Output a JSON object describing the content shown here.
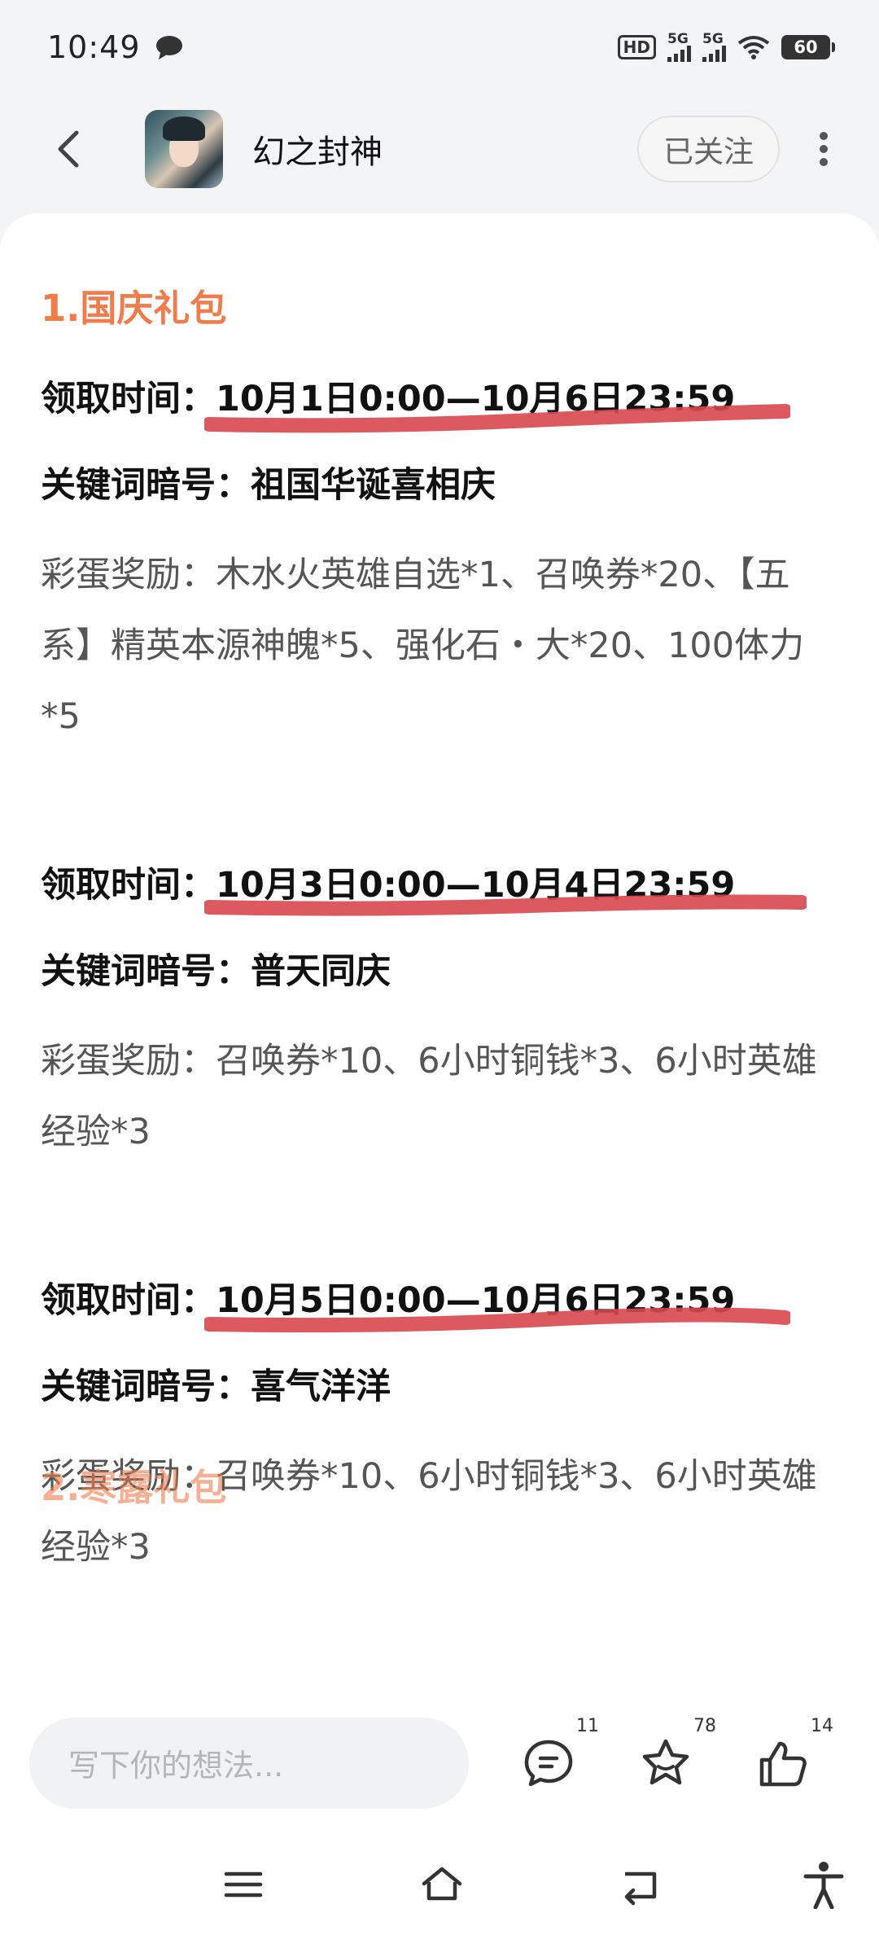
{
  "status_bar": {
    "time": "10:49",
    "hd": "HD",
    "signal1": "5G",
    "signal2": "5G",
    "battery": "60"
  },
  "header": {
    "title": "幻之封神",
    "follow_label": "已关注"
  },
  "article": {
    "section_title": "1.国庆礼包",
    "time_label": "领取时间：",
    "key_label": "关键词暗号：",
    "blocks": [
      {
        "time": "10月1日0:00—10月6日23:59",
        "keyword": "祖国华诞喜相庆",
        "reward": "彩蛋奖励：木水火英雄自选*1、召唤券*20、【五系】精英本源神魄*5、强化石・大*20、100体力*5"
      },
      {
        "time": "10月3日0:00—10月4日23:59",
        "keyword": "普天同庆",
        "reward": "彩蛋奖励：召唤券*10、6小时铜钱*3、6小时英雄经验*3"
      },
      {
        "time": "10月5日0:00—10月6日23:59",
        "keyword": "喜气洋洋",
        "reward": "彩蛋奖励：召唤券*10、6小时铜钱*3、6小时英雄经验*3"
      }
    ],
    "next_section_title": "2.寒露礼包"
  },
  "bottom_bar": {
    "input_placeholder": "写下你的想法...",
    "comments_count": "11",
    "favorites_count": "78",
    "likes_count": "14"
  },
  "colors": {
    "accent": "#f07c4c",
    "underline": "#d9474f"
  }
}
